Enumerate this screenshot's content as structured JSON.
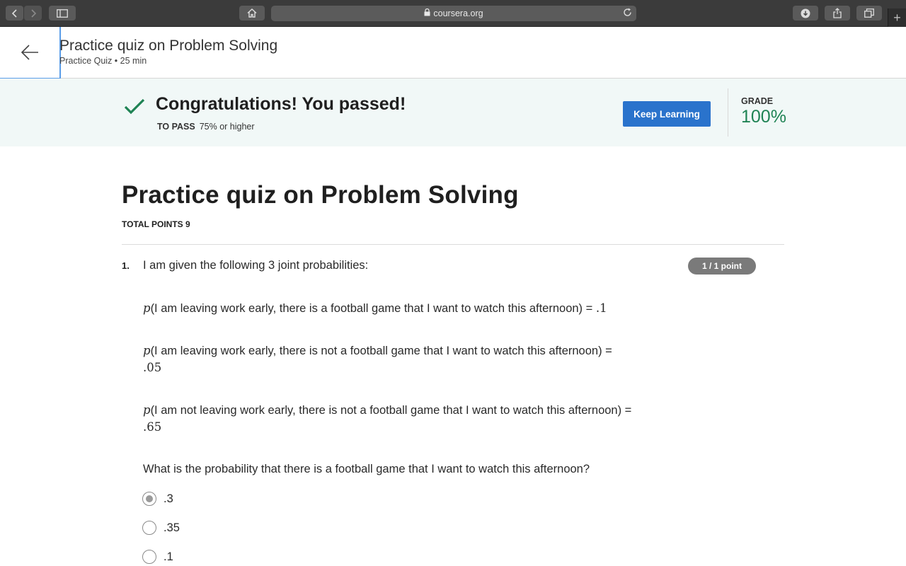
{
  "browser": {
    "url": "coursera.org",
    "icons": [
      "back-arrow-icon",
      "forward-arrow-icon",
      "sidebar-icon",
      "home-icon",
      "lock-icon",
      "reload-icon",
      "download-icon",
      "share-icon",
      "tabs-icon",
      "new-tab-icon"
    ],
    "new_tab_label": "+"
  },
  "header": {
    "title": "Practice quiz on Problem Solving",
    "subtitle": "Practice Quiz • 25 min",
    "back_icon": "back-arrow-icon"
  },
  "banner": {
    "message": "Congratulations! You passed!",
    "to_pass_label": "TO PASS",
    "to_pass_value": "75% or higher",
    "button_label": "Keep Learning",
    "grade_label": "GRADE",
    "grade_value": "100%",
    "colors": {
      "background": "#f1f8f7",
      "check": "#1f8354",
      "button": "#2a73cc",
      "grade": "#1f8354"
    }
  },
  "quiz": {
    "title": "Practice quiz on Problem Solving",
    "total_points": "TOTAL POINTS 9"
  },
  "question1": {
    "number": "1.",
    "intro": "I am given the following 3 joint probabilities:",
    "points": "1 / 1 point",
    "p_symbol": "p",
    "probabilities": [
      {
        "text": "(I am leaving work early, there is a football game that I want to watch this afternoon) = ",
        "value": ".1"
      },
      {
        "text": "(I am leaving work early, there is not a football game that I want to watch this afternoon) = ",
        "value": ".05"
      },
      {
        "text": "(I am not leaving work early, there is not a football game that I want to watch this afternoon) = ",
        "value": ".65"
      }
    ],
    "question": "What is the probability that there is a football game that I want to watch this afternoon?",
    "options": [
      {
        "label": ".3",
        "selected": true
      },
      {
        "label": ".35",
        "selected": false
      },
      {
        "label": ".1",
        "selected": false
      }
    ]
  }
}
